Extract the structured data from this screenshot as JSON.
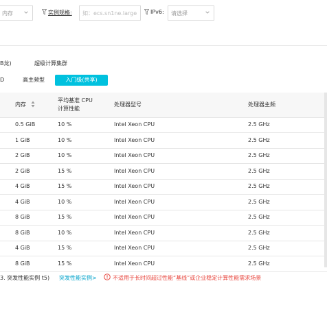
{
  "filters": {
    "memory_select": "内存",
    "instance_spec_label": "实例规格:",
    "instance_spec_placeholder": "如：ecs.sn1ne.large",
    "ipv6_label": "IPv6:",
    "ipv6_select": "请选择"
  },
  "categories": {
    "partial_label": "B龙)",
    "supercompute_label": "超级计算集群"
  },
  "tabs": {
    "partial_tab": "D",
    "high_freq_tab": "高主频型",
    "entry_tab": "入门级(共享)"
  },
  "table": {
    "headers": {
      "memory": "内存",
      "baseline_line1": "平均基准 CPU",
      "baseline_line2": "计算性能",
      "processor_model": "处理器型号",
      "processor_freq": "处理器主频"
    },
    "rows": [
      {
        "memory": "0.5 GiB",
        "baseline": "10 %",
        "model": "Intel Xeon CPU",
        "freq": "2.5 GHz"
      },
      {
        "memory": "1 GiB",
        "baseline": "10 %",
        "model": "Intel Xeon CPU",
        "freq": "2.5 GHz"
      },
      {
        "memory": "2 GiB",
        "baseline": "10 %",
        "model": "Intel Xeon CPU",
        "freq": "2.5 GHz"
      },
      {
        "memory": "2 GiB",
        "baseline": "15 %",
        "model": "Intel Xeon CPU",
        "freq": "2.5 GHz"
      },
      {
        "memory": "4 GiB",
        "baseline": "15 %",
        "model": "Intel Xeon CPU",
        "freq": "2.5 GHz"
      },
      {
        "memory": "4 GiB",
        "baseline": "10 %",
        "model": "Intel Xeon CPU",
        "freq": "2.5 GHz"
      },
      {
        "memory": "8 GiB",
        "baseline": "15 %",
        "model": "Intel Xeon CPU",
        "freq": "2.5 GHz"
      },
      {
        "memory": "8 GiB",
        "baseline": "10 %",
        "model": "Intel Xeon CPU",
        "freq": "2.5 GHz"
      },
      {
        "memory": "4 GiB",
        "baseline": "15 %",
        "model": "Intel Xeon CPU",
        "freq": "2.5 GHz"
      },
      {
        "memory": "8 GiB",
        "baseline": "15 %",
        "model": "Intel Xeon CPU",
        "freq": "2.5 GHz"
      }
    ]
  },
  "footer": {
    "burst_note": "3. 突发性能实例 t5)",
    "burst_link": "突发性能实例>",
    "warning_text": "不适用于长时间超过性能“基线”或企业稳定计算性能需求场景"
  },
  "colors": {
    "accent": "#00c1de",
    "link": "#00a2ca",
    "warning": "#e8473f"
  },
  "icons": {
    "funnel": "filter-icon",
    "caret": "chevron-down-icon",
    "sort": "sort-icon",
    "warning": "warning-circle-icon"
  }
}
